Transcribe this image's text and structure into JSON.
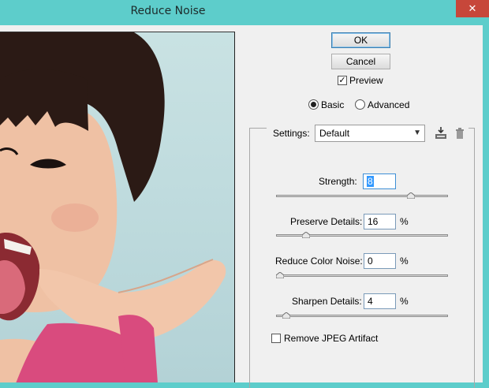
{
  "window": {
    "title": "Reduce Noise",
    "close_symbol": "✕"
  },
  "buttons": {
    "ok": "OK",
    "cancel": "Cancel"
  },
  "preview": {
    "label": "Preview",
    "checked": true
  },
  "mode": {
    "basic": "Basic",
    "advanced": "Advanced",
    "selected": "basic"
  },
  "settings": {
    "label": "Settings:",
    "value": "Default"
  },
  "strength": {
    "label": "Strength:",
    "value": "8",
    "slider_fraction": 0.8
  },
  "preserve_details": {
    "label": "Preserve Details:",
    "value": "16",
    "unit": "%",
    "slider_fraction": 0.16
  },
  "reduce_color_noise": {
    "label": "Reduce Color Noise:",
    "value": "0",
    "unit": "%",
    "slider_fraction": 0.0
  },
  "sharpen_details": {
    "label": "Sharpen Details:",
    "value": "4",
    "unit": "%",
    "slider_fraction": 0.04
  },
  "jpeg": {
    "label": "Remove JPEG Artifact",
    "checked": false
  },
  "icons": [
    "close-icon",
    "save-preset-icon",
    "delete-preset-icon",
    "dropdown-arrow-icon",
    "slider-thumb-icon"
  ],
  "colors": {
    "title_bar": "#5dcdcb",
    "dialog_bg": "#f0f0f0",
    "selection": "#3399ff"
  }
}
